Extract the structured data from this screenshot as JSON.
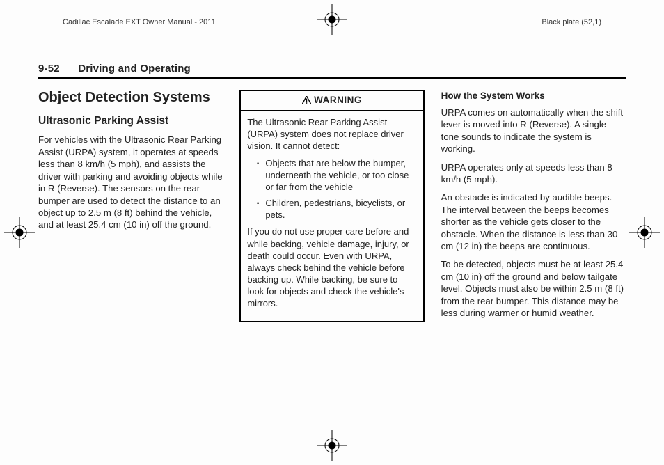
{
  "meta": {
    "manual_title": "Cadillac Escalade EXT Owner Manual - 2011",
    "plate": "Black plate (52,1)"
  },
  "running_head": {
    "page_number": "9-52",
    "chapter": "Driving and Operating"
  },
  "col1": {
    "h1": "Object Detection Systems",
    "h2": "Ultrasonic Parking Assist",
    "p1": "For vehicles with the Ultrasonic Rear Parking Assist (URPA) system, it operates at speeds less than 8 km/h (5 mph), and assists the driver with parking and avoiding objects while in R (Reverse). The sensors on the rear bumper are used to detect the distance to an object up to 2.5 m (8 ft) behind the vehicle, and at least 25.4 cm (10 in) off the ground."
  },
  "col2": {
    "warning_label": "WARNING",
    "w_p1": "The Ultrasonic Rear Parking Assist (URPA) system does not replace driver vision. It cannot detect:",
    "w_li1": "Objects that are below the bumper, underneath the vehicle, or too close or far from the vehicle",
    "w_li2": "Children, pedestrians, bicyclists, or pets.",
    "w_p2": "If you do not use proper care before and while backing, vehicle damage, injury, or death could occur. Even with URPA, always check behind the vehicle before backing up. While backing, be sure to look for objects and check the vehicle's mirrors."
  },
  "col3": {
    "h3": "How the System Works",
    "p1": "URPA comes on automatically when the shift lever is moved into R (Reverse). A single tone sounds to indicate the system is working.",
    "p2": "URPA operates only at speeds less than 8 km/h (5 mph).",
    "p3": "An obstacle is indicated by audible beeps. The interval between the beeps becomes shorter as the vehicle gets closer to the obstacle. When the distance is less than 30 cm (12 in) the beeps are continuous.",
    "p4": "To be detected, objects must be at least 25.4 cm (10 in) off the ground and below tailgate level. Objects must also be within 2.5 m (8 ft) from the rear bumper. This distance may be less during warmer or humid weather."
  }
}
